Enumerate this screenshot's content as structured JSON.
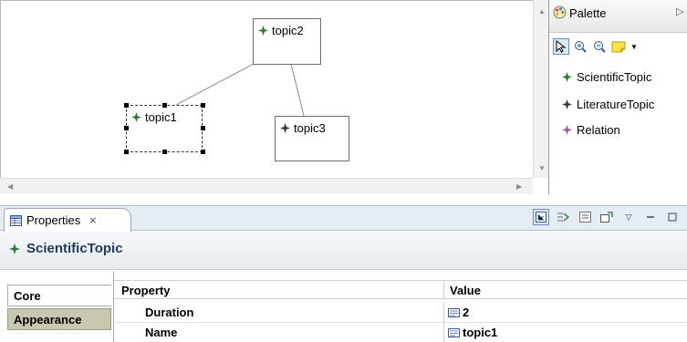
{
  "colors": {
    "scientific_topic": "#2f7d32",
    "literature_topic": "#3a3a3a",
    "relation": "#a05a9e",
    "header_text": "#1f3b5c",
    "inactive_tab": "#c8c8b0"
  },
  "diagram": {
    "nodes": [
      {
        "label": "topic2",
        "icon": "scientific-topic-icon"
      },
      {
        "label": "topic1",
        "icon": "scientific-topic-icon",
        "selected": true
      },
      {
        "label": "topic3",
        "icon": "literature-topic-icon"
      }
    ]
  },
  "palette": {
    "title": "Palette",
    "tools": [
      "select-tool-icon",
      "zoom-in-icon",
      "zoom-out-icon",
      "note-icon",
      "dropdown-icon"
    ],
    "items": [
      {
        "label": "ScientificTopic",
        "icon": "scientific-topic-icon"
      },
      {
        "label": "LiteratureTopic",
        "icon": "literature-topic-icon"
      },
      {
        "label": "Relation",
        "icon": "relation-icon"
      }
    ]
  },
  "properties": {
    "tab_label": "Properties",
    "close_glyph": "⨯",
    "title": "ScientificTopic",
    "side_tabs": [
      {
        "label": "Core",
        "active": true
      },
      {
        "label": "Appearance",
        "active": false
      }
    ],
    "columns": [
      "Property",
      "Value"
    ],
    "rows": [
      {
        "property": "Duration",
        "value": "2"
      },
      {
        "property": "Name",
        "value": "topic1"
      }
    ]
  }
}
